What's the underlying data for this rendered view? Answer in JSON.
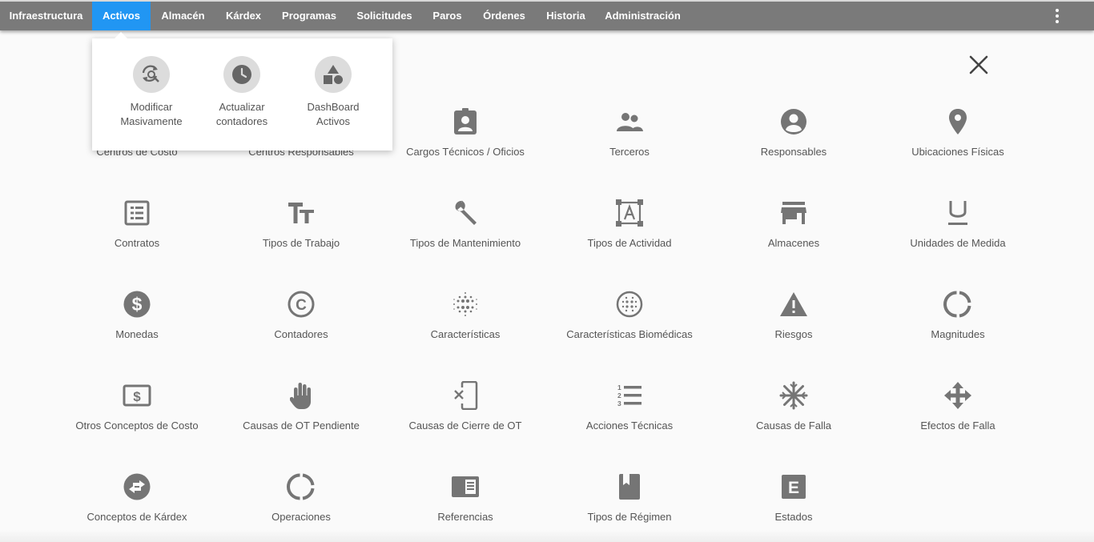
{
  "nav": {
    "items": [
      {
        "label": "Infraestructura",
        "active": false
      },
      {
        "label": "Activos",
        "active": true
      },
      {
        "label": "Almacén",
        "active": false
      },
      {
        "label": "Kárdex",
        "active": false
      },
      {
        "label": "Programas",
        "active": false
      },
      {
        "label": "Solicitudes",
        "active": false
      },
      {
        "label": "Paros",
        "active": false
      },
      {
        "label": "Órdenes",
        "active": false
      },
      {
        "label": "Historia",
        "active": false
      },
      {
        "label": "Administración",
        "active": false
      }
    ],
    "accent": "#2196f3",
    "bar_color": "#7a7a7a"
  },
  "dropdown": {
    "items": [
      {
        "line1": "Modificar",
        "line2": "Masivamente",
        "icon": "sync-search-icon"
      },
      {
        "line1": "Actualizar",
        "line2": "contadores",
        "icon": "clock-icon"
      },
      {
        "line1": "DashBoard",
        "line2": "Activos",
        "icon": "shapes-icon"
      }
    ]
  },
  "grid": {
    "rows": [
      [
        "Centros de Costo",
        "Centros Responsables",
        "Cargos Técnicos / Oficios",
        "Terceros",
        "Responsables",
        "Ubicaciones Físicas"
      ],
      [
        "Contratos",
        "Tipos de Trabajo",
        "Tipos de Mantenimiento",
        "Tipos de Actividad",
        "Almacenes",
        "Unidades de Medida"
      ],
      [
        "Monedas",
        "Contadores",
        "Características",
        "Características Biomédicas",
        "Riesgos",
        "Magnitudes"
      ],
      [
        "Otros Conceptos de Costo",
        "Causas de OT Pendiente",
        "Causas de Cierre de OT",
        "Acciones Técnicas",
        "Causas de Falla",
        "Efectos de Falla"
      ],
      [
        "Conceptos de Kárdex",
        "Operaciones",
        "Referencias",
        "Tipos de Régimen",
        "Estados"
      ]
    ],
    "icon_color": "#757575"
  }
}
